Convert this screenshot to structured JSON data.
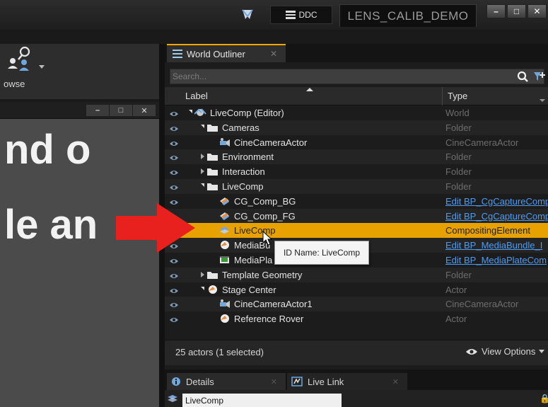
{
  "titlebar": {
    "ddc_label": "DDC",
    "project_name": "LENS_CALIB_DEMO",
    "window_buttons": [
      "–",
      "□",
      "✕"
    ]
  },
  "toolbar": {
    "browse_label": "owse"
  },
  "viewport": {
    "window_buttons": [
      "–",
      "□",
      "✕"
    ],
    "overlay_text_lines": [
      "nd o",
      "le an"
    ]
  },
  "outliner": {
    "tab_label": "World Outliner",
    "tab_close": "✕",
    "search_placeholder": "Search...",
    "columns": {
      "label": "Label",
      "type": "Type"
    },
    "rows": [
      {
        "label": "LiveComp (Editor)",
        "type": "World",
        "icon": "world-icon",
        "depth": 0,
        "expander": "open",
        "link": false
      },
      {
        "label": "Cameras",
        "type": "Folder",
        "icon": "folder-icon",
        "depth": 1,
        "expander": "open",
        "link": false
      },
      {
        "label": "CineCameraActor",
        "type": "CineCameraActor",
        "icon": "camera-icon",
        "depth": 2,
        "expander": "none",
        "link": false
      },
      {
        "label": "Environment",
        "type": "Folder",
        "icon": "folder-icon",
        "depth": 1,
        "expander": "closed",
        "link": false
      },
      {
        "label": "Interaction",
        "type": "Folder",
        "icon": "folder-icon",
        "depth": 1,
        "expander": "closed",
        "link": false
      },
      {
        "label": "LiveComp",
        "type": "Folder",
        "icon": "folder-icon",
        "depth": 1,
        "expander": "open",
        "link": false
      },
      {
        "label": "CG_Comp_BG",
        "type": "Edit BP_CgCaptureCompE",
        "icon": "composite-icon",
        "depth": 2,
        "expander": "none",
        "link": true
      },
      {
        "label": "CG_Comp_FG",
        "type": "Edit BP_CgCaptureCompE",
        "icon": "composite-icon",
        "depth": 2,
        "expander": "none",
        "link": true
      },
      {
        "label": "LiveComp",
        "type": "CompositingElement",
        "icon": "compositing-element-icon",
        "depth": 2,
        "expander": "none",
        "link": false,
        "selected": true
      },
      {
        "label": "MediaBu",
        "type": "Edit BP_MediaBundle_I",
        "icon": "sphere-icon",
        "depth": 2,
        "expander": "none",
        "link": true
      },
      {
        "label": "MediaPla",
        "type": "Edit BP_MediaPlateCom",
        "icon": "media-plate-icon",
        "depth": 2,
        "expander": "none",
        "link": true
      },
      {
        "label": "Template Geometry",
        "type": "Folder",
        "icon": "folder-icon",
        "depth": 1,
        "expander": "closed",
        "link": false
      },
      {
        "label": "Stage Center",
        "type": "Actor",
        "icon": "sphere-icon",
        "depth": 1,
        "expander": "open",
        "link": false
      },
      {
        "label": "CineCameraActor1",
        "type": "CineCameraActor",
        "icon": "camera-icon",
        "depth": 2,
        "expander": "none",
        "link": false
      },
      {
        "label": "Reference Rover",
        "type": "Actor",
        "icon": "sphere-icon",
        "depth": 2,
        "expander": "none",
        "link": false
      }
    ],
    "tooltip": "ID Name: LiveComp",
    "status": "25 actors (1 selected)",
    "view_options": "View Options"
  },
  "bottom_panel": {
    "tabs": [
      {
        "label": "Details",
        "icon": "details-icon",
        "close": "✕"
      },
      {
        "label": "Live Link",
        "icon": "live-link-icon",
        "close": "✕"
      }
    ],
    "name_value": "LiveComp"
  },
  "colors": {
    "selection": "#e7a200",
    "link": "#4a9cf5",
    "annotation_arrow": "#e8201e",
    "tab_accent": "#f0a500"
  }
}
